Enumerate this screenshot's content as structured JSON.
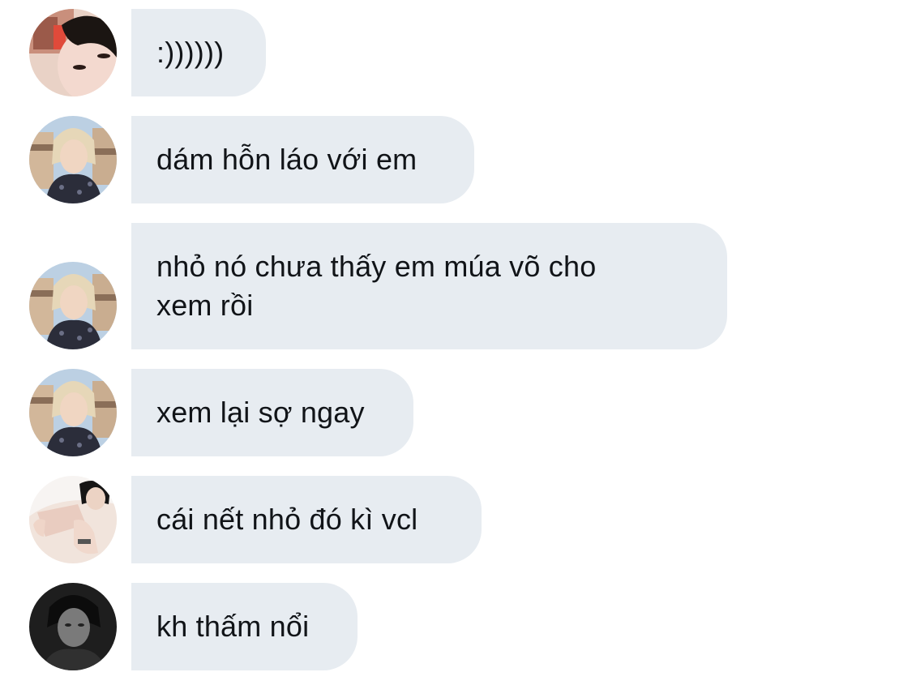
{
  "messages": [
    {
      "avatar": "avatar-girl-selfie",
      "text": ":))))))"
    },
    {
      "avatar": "avatar-blonde-man",
      "text": "dám hỗn láo với em"
    },
    {
      "avatar": "avatar-blonde-man",
      "text": "nhỏ nó chưa thấy em múa võ cho\nxem rồi"
    },
    {
      "avatar": "avatar-blonde-man",
      "text": "xem lại sợ ngay"
    },
    {
      "avatar": "avatar-white-shirt-man",
      "text": "cái nết nhỏ đó kì vcl"
    },
    {
      "avatar": "avatar-dark-portrait",
      "text": "kh thấm nổi"
    }
  ],
  "colors": {
    "bubble_bg": "#e7ecf1",
    "text": "#111418",
    "background": "#ffffff"
  }
}
